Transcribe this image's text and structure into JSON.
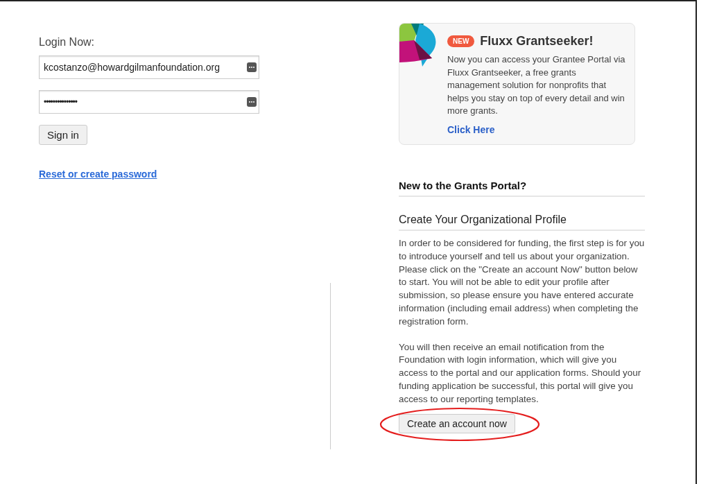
{
  "login": {
    "heading": "Login Now:",
    "email": {
      "value": "kcostanzo@howardgilmanfoundation.org"
    },
    "password": {
      "value": "•••••••••••••••"
    },
    "sign_in": "Sign in",
    "reset_link": "Reset or create password"
  },
  "promo": {
    "badge": "NEW",
    "title": "Fluxx Grantseeker!",
    "text": "Now you can access your Grantee Portal via Fluxx Grantseeker, a free grants management solution for nonprofits that helps you stay on top of every detail and win more grants.",
    "link": "Click Here"
  },
  "register": {
    "heading": "New to the Grants Portal?",
    "subheading": "Create Your Organizational Profile",
    "paragraphs": [
      "In order to be considered for funding, the first step is for you to introduce yourself and tell us about your organization. Please click on the \"Create an account Now\" button below to start. You will not be able to edit your profile after submission, so please ensure you have entered accurate information (including email address) when completing the registration form.",
      "You will then receive an email notification from the Foundation with login information, which will give you access to the portal and our application forms. Should your funding application be successful, this portal will give you access to our reporting templates."
    ],
    "button": "Create an account now"
  }
}
